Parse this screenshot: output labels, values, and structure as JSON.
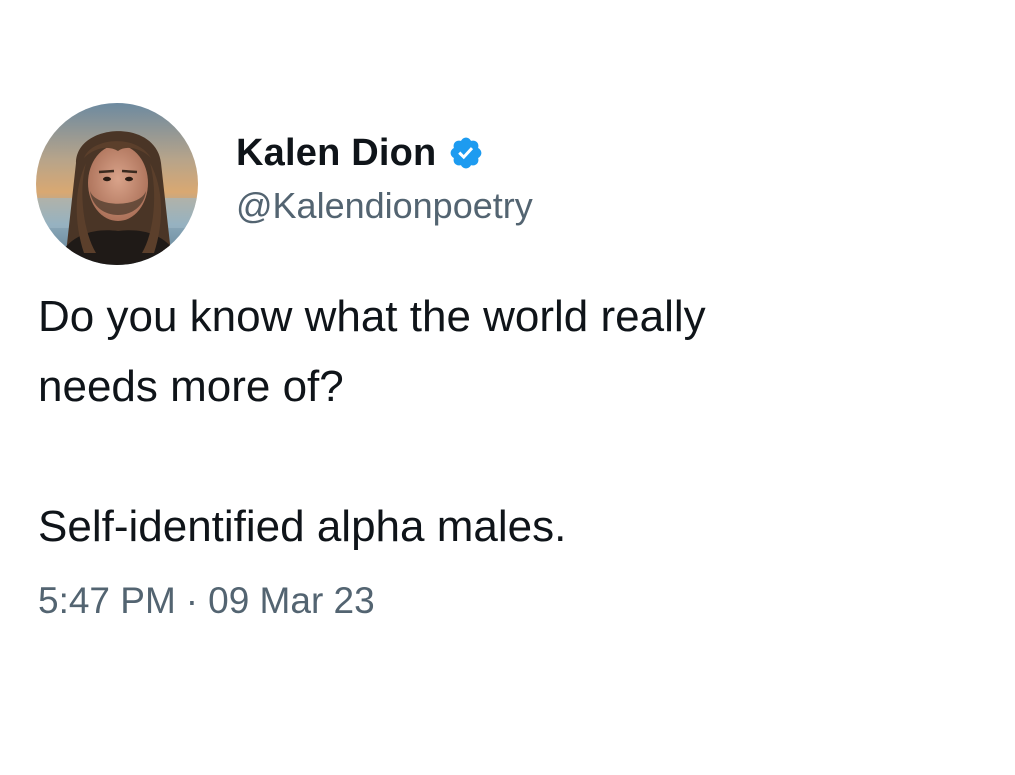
{
  "user": {
    "display_name": "Kalen Dion",
    "handle": "@Kalendionpoetry",
    "verified": true,
    "avatar_icon": "profile-photo",
    "verified_icon": "verified-badge-icon"
  },
  "tweet": {
    "line1": "Do you know what the world really",
    "line2": "needs more of?",
    "line3": "Self-identified alpha males."
  },
  "meta": {
    "time": "5:47 PM",
    "separator": "·",
    "date": "09 Mar 23"
  },
  "colors": {
    "text_primary": "#0f1419",
    "text_secondary": "#536471",
    "verified_blue": "#1d9bf0"
  }
}
